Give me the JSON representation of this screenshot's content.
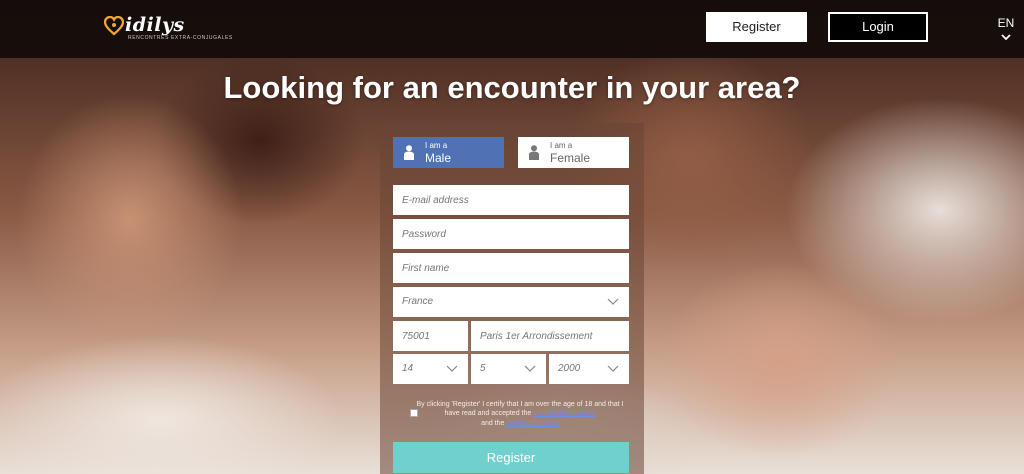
{
  "header": {
    "logo_text": "idilys",
    "logo_tagline": "RENCONTRES EXTRA-CONJUGALES",
    "register_label": "Register",
    "login_label": "Login",
    "language": "EN"
  },
  "hero": {
    "headline": "Looking for an encounter in your area?"
  },
  "form": {
    "gender_male": {
      "small": "I am a",
      "big": "Male"
    },
    "gender_female": {
      "small": "I am a",
      "big": "Female"
    },
    "email_placeholder": "E-mail address",
    "password_placeholder": "Password",
    "firstname_placeholder": "First name",
    "country": "France",
    "postcode_placeholder": "75001",
    "city_placeholder": "Paris 1er Arrondissement",
    "birth_day": "14",
    "birth_month": "5",
    "birth_year": "2000",
    "consent_prefix": "By clicking 'Register' I certify that I am over the age of 18 and that I have read and accepted the",
    "privacy_link": "confidentiality policy",
    "consent_mid": "and the",
    "terms_link": "conditions of use",
    "submit_label": "Register"
  },
  "colors": {
    "accent_male": "#4f72b4",
    "register_button": "#6fd0ce",
    "logo_heart": "#f0a531"
  }
}
